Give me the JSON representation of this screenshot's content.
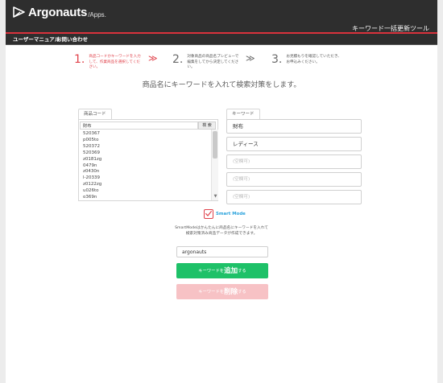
{
  "header": {
    "logo_text": "Argonauts",
    "logo_suffix": "/Apps.",
    "tool_title": "キーワード一括更新ツール"
  },
  "nav": {
    "items": [
      {
        "label": "ユーザーマニュアル"
      },
      {
        "label": "お問い合わせ"
      }
    ]
  },
  "steps": [
    {
      "num": "1.",
      "text": "商品コードかキーワードを入力して、作業商品を選択してください。",
      "state": "active"
    },
    {
      "num": "2.",
      "text": "対象商品の商品名プレビューで編集をしてから決定してください。",
      "state": "inactive"
    },
    {
      "num": "3.",
      "text": "お見積もりを確認していただき、お申込みください。",
      "state": "inactive"
    }
  ],
  "chevron": "≫",
  "headline": "商品名にキーワードを入れて検索対策をします。",
  "left_panel": {
    "tab_label": "商品コード",
    "search_value": "財布",
    "search_button": "検 索",
    "codes": [
      "520367",
      "p005to",
      "520372",
      "520369",
      "z0181zg",
      "0479n",
      "z0430n",
      "l-20339",
      "z0122zg",
      "u026to",
      "o369n"
    ]
  },
  "right_panel": {
    "tab_label": "キーワード",
    "keywords": [
      {
        "value": "財布",
        "empty": false
      },
      {
        "value": "レディース",
        "empty": false
      },
      {
        "value": "(空欄可)",
        "empty": true
      },
      {
        "value": "(空欄可)",
        "empty": true
      },
      {
        "value": "(空欄可)",
        "empty": true
      }
    ]
  },
  "smart_mode": {
    "label": "Smart Mode",
    "checked": true,
    "description_line1": "SmartModeはかんたんに商品名にキーワードを入れて",
    "description_line2": "検索対策済み商品データが作成できます。"
  },
  "keyword_input": {
    "value": "argonauts"
  },
  "buttons": {
    "add": {
      "prefix": "キーワードを",
      "main": "追加",
      "suffix": "する"
    },
    "delete": {
      "prefix": "キーワードを",
      "main": "削除",
      "suffix": "する"
    }
  },
  "colors": {
    "accent_red": "#e0414a",
    "header_dark": "#2e2e2e",
    "add_green": "#1ec168",
    "delete_pink": "#f7c2c5",
    "smart_blue": "#2ba3dc"
  },
  "icons": {
    "logo": "argonauts-logo-icon",
    "check": "checkmark-icon",
    "step_arrow": "double-chevron-right-icon"
  }
}
